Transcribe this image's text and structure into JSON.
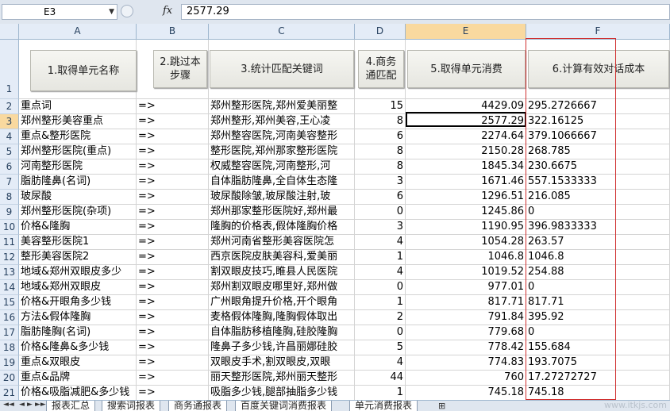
{
  "formula_bar": {
    "name_box": "E3",
    "formula": "2577.29",
    "fx_label": "fx"
  },
  "columns": [
    "A",
    "B",
    "C",
    "D",
    "E",
    "F"
  ],
  "header_row_number": "1",
  "buttons": {
    "a": "1.取得单元名称",
    "b": "2.跳过本步骤",
    "c": "3.统计匹配关键词",
    "d": "4.商务通匹配",
    "e": "5.取得单元消费",
    "f": "6.计算有效对话成本"
  },
  "rows": [
    {
      "n": "2",
      "a": "重点词",
      "b": "=>",
      "c": "郑州整形医院,郑州爱美丽整",
      "d": "15",
      "e": "4429.09",
      "f": "295.2726667"
    },
    {
      "n": "3",
      "a": "郑州整形美容重点",
      "b": "=>",
      "c": "郑州整形,郑州美容,王心凌",
      "d": "8",
      "e": "2577.29",
      "f": "322.16125"
    },
    {
      "n": "4",
      "a": "重点&整形医院",
      "b": "=>",
      "c": "郑州整容医院,河南美容整形",
      "d": "6",
      "e": "2274.64",
      "f": "379.1066667"
    },
    {
      "n": "5",
      "a": "郑州整形医院(重点)",
      "b": "=>",
      "c": "整形医院,郑州那家整形医院",
      "d": "8",
      "e": "2150.28",
      "f": "268.785"
    },
    {
      "n": "6",
      "a": "河南整形医院",
      "b": "=>",
      "c": "权威整容医院,河南整形,河",
      "d": "8",
      "e": "1845.34",
      "f": "230.6675"
    },
    {
      "n": "7",
      "a": "脂肪隆鼻(名词)",
      "b": "=>",
      "c": "自体脂肪隆鼻,全自体生态隆",
      "d": "3",
      "e": "1671.46",
      "f": "557.1533333"
    },
    {
      "n": "8",
      "a": "玻尿酸",
      "b": "=>",
      "c": "玻尿酸除皱,玻尿酸注射,玻",
      "d": "6",
      "e": "1296.51",
      "f": "216.085"
    },
    {
      "n": "9",
      "a": "郑州整形医院(杂项)",
      "b": "=>",
      "c": "郑州那家整形医院好,郑州最",
      "d": "0",
      "e": "1245.86",
      "f": "0"
    },
    {
      "n": "10",
      "a": "价格&隆胸",
      "b": "=>",
      "c": "隆胸的价格表,假体隆胸价格",
      "d": "3",
      "e": "1190.95",
      "f": "396.9833333"
    },
    {
      "n": "11",
      "a": "美容整形医院1",
      "b": "=>",
      "c": "郑州河南省整形美容医院怎",
      "d": "4",
      "e": "1054.28",
      "f": "263.57"
    },
    {
      "n": "12",
      "a": "整形美容医院2",
      "b": "=>",
      "c": "西京医院皮肤美容科,爱美丽",
      "d": "1",
      "e": "1046.8",
      "f": "1046.8"
    },
    {
      "n": "13",
      "a": "地域&郑州双眼皮多少",
      "b": "=>",
      "c": "割双眼皮技巧,睢县人民医院",
      "d": "4",
      "e": "1019.52",
      "f": "254.88"
    },
    {
      "n": "14",
      "a": "地域&郑州双眼皮",
      "b": "=>",
      "c": "郑州割双眼皮哪里好,郑州做",
      "d": "0",
      "e": "977.01",
      "f": "0"
    },
    {
      "n": "15",
      "a": "价格&开眼角多少钱",
      "b": "=>",
      "c": "广州眼角提升价格,开个眼角",
      "d": "1",
      "e": "817.71",
      "f": "817.71"
    },
    {
      "n": "16",
      "a": "方法&假体隆胸",
      "b": "=>",
      "c": "麦格假体隆胸,隆胸假体取出",
      "d": "2",
      "e": "791.84",
      "f": "395.92"
    },
    {
      "n": "17",
      "a": "脂肪隆胸(名词)",
      "b": "=>",
      "c": "自体脂肪移植隆胸,硅胶隆胸",
      "d": "0",
      "e": "779.68",
      "f": "0"
    },
    {
      "n": "18",
      "a": "价格&隆鼻&多少钱",
      "b": "=>",
      "c": "隆鼻子多少钱,许昌丽娜硅胶",
      "d": "5",
      "e": "778.42",
      "f": "155.684"
    },
    {
      "n": "19",
      "a": "重点&双眼皮",
      "b": "=>",
      "c": "双眼皮手术,割双眼皮,双眼",
      "d": "4",
      "e": "774.83",
      "f": "193.7075"
    },
    {
      "n": "20",
      "a": "重点&品牌",
      "b": "=>",
      "c": "丽天整形医院,郑州丽天整形",
      "d": "44",
      "e": "760",
      "f": "17.27272727"
    },
    {
      "n": "21",
      "a": "价格&吸脂减肥&多少钱",
      "b": "=>",
      "c": "吸脂多少钱,腿部抽脂多少钱",
      "d": "1",
      "e": "745.18",
      "f": "745.18"
    }
  ],
  "sheet_tabs": [
    "报表汇总",
    "搜索词报表",
    "商务通报表",
    "百度关键词消费报表",
    "单元消费报表"
  ],
  "watermark": "www.itkjs.com",
  "colors": {
    "selected_header": "#f9d99f",
    "header_bg": "#e4ecf7",
    "red_box": "#d03030"
  }
}
